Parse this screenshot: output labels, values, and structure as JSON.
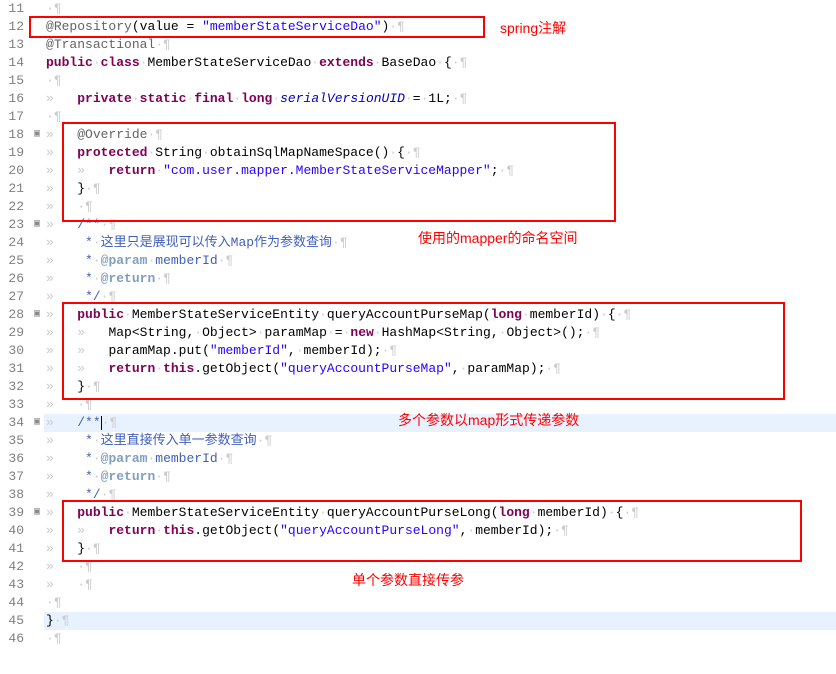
{
  "lineNumbers": [
    "11",
    "12",
    "13",
    "14",
    "15",
    "16",
    "17",
    "18",
    "19",
    "20",
    "21",
    "22",
    "23",
    "24",
    "25",
    "26",
    "27",
    "28",
    "29",
    "30",
    "31",
    "32",
    "33",
    "34",
    "35",
    "36",
    "37",
    "38",
    "39",
    "40",
    "41",
    "42",
    "43",
    "44",
    "45",
    "46"
  ],
  "foldMarks": [
    "",
    "",
    "",
    "",
    "",
    "",
    "",
    "▣",
    "",
    "",
    "",
    "",
    "▣",
    "",
    "",
    "",
    "",
    "▣",
    "",
    "",
    "",
    "",
    "",
    "▣",
    "",
    "",
    "",
    "",
    "▣",
    "",
    "",
    "",
    "",
    "",
    "",
    ""
  ],
  "tokens": {
    "at": "@",
    "repository": "Repository",
    "transactional": "Transactional",
    "override": "Override",
    "value": "value",
    "eq": " = ",
    "valLiteral": "\"memberStateServiceDao\"",
    "public": "public",
    "class": "class",
    "MemberStateServiceDao": "MemberStateServiceDao",
    "extends": "extends",
    "BaseDao": "BaseDao",
    "private": "private",
    "static": "static",
    "final": "final",
    "long": "long",
    "serialVersionUID": "serialVersionUID",
    "oneL": "1L",
    "protected": "protected",
    "String": "String",
    "obtainSqlMapNameSpace": "obtainSqlMapNameSpace",
    "return": "return",
    "mapperNs": "\"com.user.mapper.MemberStateServiceMapper\"",
    "docStart": "/**",
    "docLine1": "这里只是展现可以传入Map作为参数查询",
    "docLine2": "这里直接传入单一参数查询",
    "paramTag": "@param",
    "returnTag": "@return",
    "memberId": "memberId",
    "docEnd": "*/",
    "MemberStateServiceEntity": "MemberStateServiceEntity",
    "queryAccountPurseMap": "queryAccountPurseMap",
    "queryAccountPurseLong": "queryAccountPurseLong",
    "Map": "Map",
    "Object": "Object",
    "paramMap": "paramMap",
    "new": "new",
    "HashMap": "HashMap",
    "put": "put",
    "memberIdStr": "\"memberId\"",
    "this": "this",
    "getObject": "getObject",
    "qapmStr": "\"queryAccountPurseMap\"",
    "qaplStr": "\"queryAccountPurseLong\""
  },
  "annotations": {
    "a1": "spring注解",
    "a2": "使用的mapper的命名空间",
    "a3": "多个参数以map形式传递参数",
    "a4": "单个参数直接传参"
  },
  "chart_data": {
    "type": "table",
    "title": "Java code editor view",
    "lines": [
      {
        "n": 11,
        "text": ""
      },
      {
        "n": 12,
        "text": "@Repository(value = \"memberStateServiceDao\")"
      },
      {
        "n": 13,
        "text": "@Transactional"
      },
      {
        "n": 14,
        "text": "public class MemberStateServiceDao extends BaseDao {"
      },
      {
        "n": 15,
        "text": ""
      },
      {
        "n": 16,
        "text": "    private static final long serialVersionUID = 1L;"
      },
      {
        "n": 17,
        "text": ""
      },
      {
        "n": 18,
        "text": "    @Override"
      },
      {
        "n": 19,
        "text": "    protected String obtainSqlMapNameSpace() {"
      },
      {
        "n": 20,
        "text": "        return \"com.user.mapper.MemberStateServiceMapper\";"
      },
      {
        "n": 21,
        "text": "    }"
      },
      {
        "n": 22,
        "text": ""
      },
      {
        "n": 23,
        "text": "    /**"
      },
      {
        "n": 24,
        "text": "     * 这里只是展现可以传入Map作为参数查询"
      },
      {
        "n": 25,
        "text": "     * @param memberId"
      },
      {
        "n": 26,
        "text": "     * @return"
      },
      {
        "n": 27,
        "text": "     */"
      },
      {
        "n": 28,
        "text": "    public MemberStateServiceEntity queryAccountPurseMap(long memberId) {"
      },
      {
        "n": 29,
        "text": "        Map<String, Object> paramMap = new HashMap<String, Object>();"
      },
      {
        "n": 30,
        "text": "        paramMap.put(\"memberId\", memberId);"
      },
      {
        "n": 31,
        "text": "        return this.getObject(\"queryAccountPurseMap\", paramMap);"
      },
      {
        "n": 32,
        "text": "    }"
      },
      {
        "n": 33,
        "text": ""
      },
      {
        "n": 34,
        "text": "    /**"
      },
      {
        "n": 35,
        "text": "     * 这里直接传入单一参数查询"
      },
      {
        "n": 36,
        "text": "     * @param memberId"
      },
      {
        "n": 37,
        "text": "     * @return"
      },
      {
        "n": 38,
        "text": "     */"
      },
      {
        "n": 39,
        "text": "    public MemberStateServiceEntity queryAccountPurseLong(long memberId) {"
      },
      {
        "n": 40,
        "text": "        return this.getObject(\"queryAccountPurseLong\", memberId);"
      },
      {
        "n": 41,
        "text": "    }"
      },
      {
        "n": 42,
        "text": ""
      },
      {
        "n": 43,
        "text": ""
      },
      {
        "n": 44,
        "text": ""
      },
      {
        "n": 45,
        "text": "}"
      },
      {
        "n": 46,
        "text": ""
      }
    ]
  }
}
